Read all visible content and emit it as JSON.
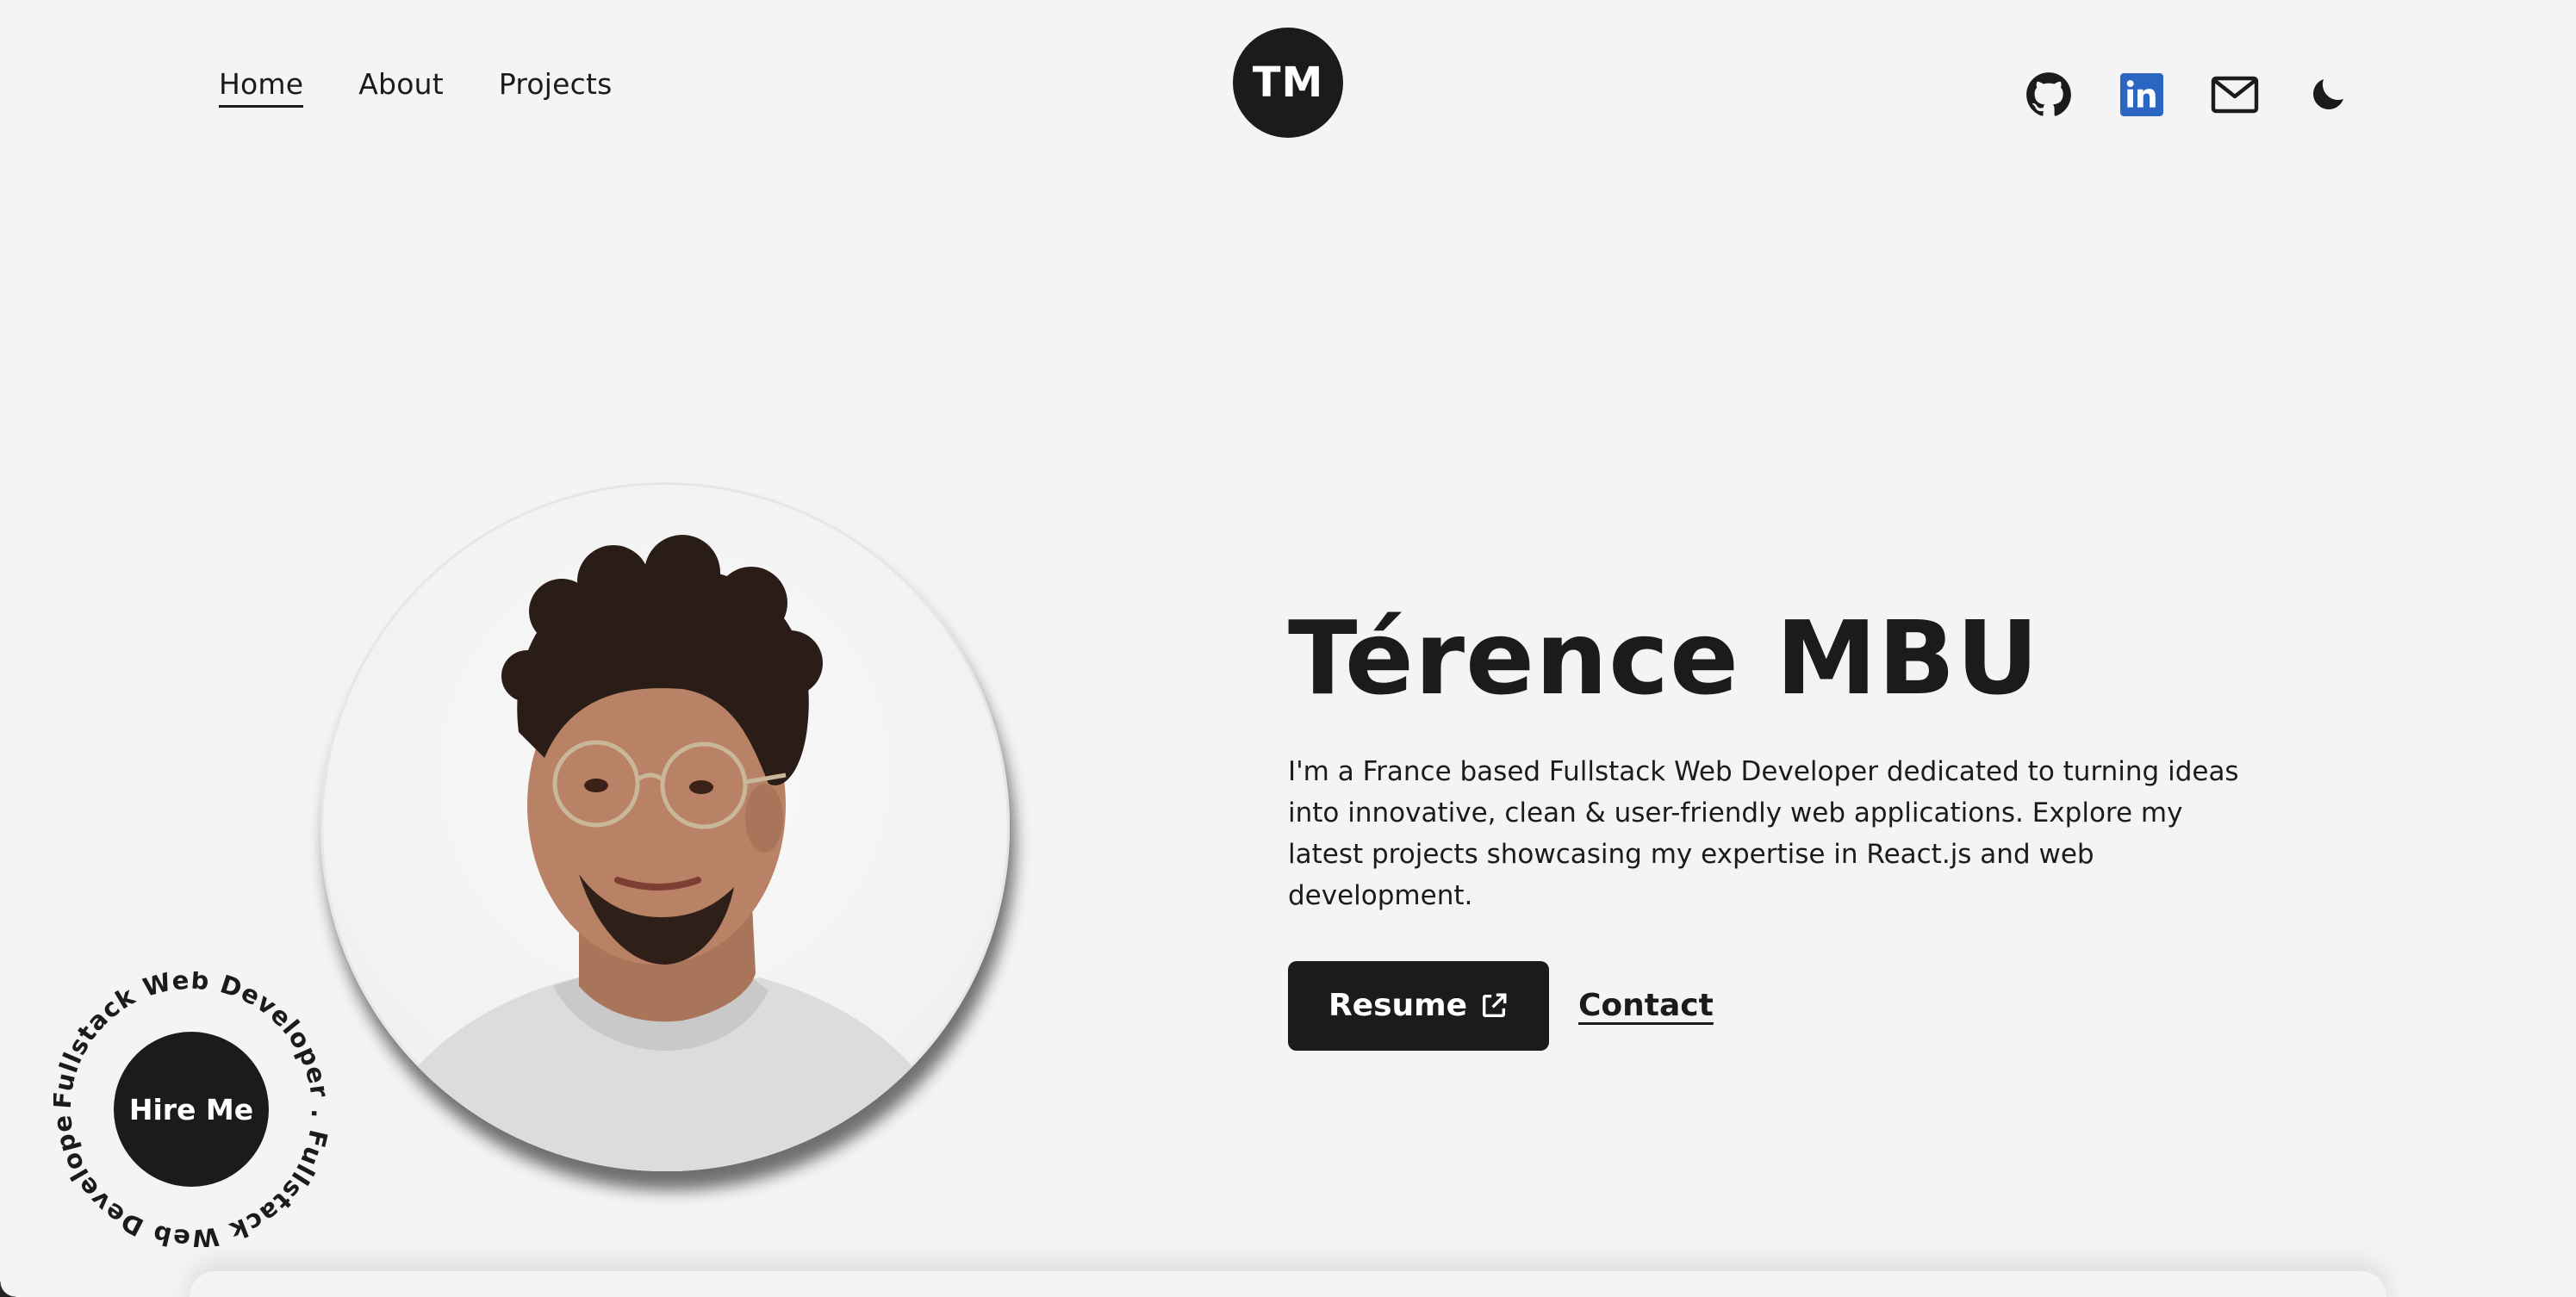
{
  "nav": {
    "links": [
      {
        "label": "Home"
      },
      {
        "label": "About"
      },
      {
        "label": "Projects"
      }
    ]
  },
  "logo": {
    "text": "TM"
  },
  "social": {
    "icons": [
      "github-icon",
      "linkedin-icon",
      "mail-icon",
      "moon-icon"
    ],
    "linkedin_color": "#2b66c2"
  },
  "hero": {
    "name": "Térence MBU",
    "description": "I'm a France based Fullstack Web Developer dedicated to turning ideas into innovative, clean & user-friendly web applications. Explore my latest projects showcasing my expertise in React.js and web development.",
    "resume_label": "Resume",
    "contact_label": "Contact"
  },
  "hire": {
    "button_label": "Hire Me",
    "ring_text": "Fullstack Web Developer . Fullstack Web Developer ."
  },
  "colors": {
    "background": "#f4f4f4",
    "primary": "#1b1b1b",
    "button_text": "#ffffff"
  }
}
